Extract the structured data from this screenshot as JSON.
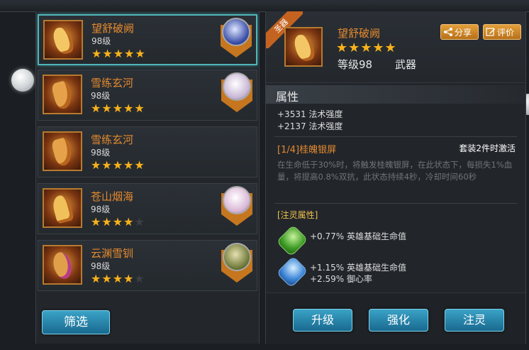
{
  "list": {
    "items": [
      {
        "name": "望舒破阙",
        "level": "98级",
        "stars_on": "★★★★★",
        "stars_off": "",
        "owner_color": "#3b4fa8"
      },
      {
        "name": "雪练玄河",
        "level": "98级",
        "stars_on": "★★★★★",
        "stars_off": "",
        "owner_color": "#c9b7d6"
      },
      {
        "name": "雪练玄河",
        "level": "98级",
        "stars_on": "★★★★★",
        "stars_off": ""
      },
      {
        "name": "苍山烟海",
        "level": "98级",
        "stars_on": "★★★★",
        "stars_off": "★",
        "owner_color": "#d9b7d6"
      },
      {
        "name": "云渊雪钏",
        "level": "98级",
        "stars_on": "★★★★",
        "stars_off": "★",
        "owner_color": "#6f7a3a"
      }
    ],
    "filter_label": "筛选"
  },
  "detail": {
    "ribbon": "圣器",
    "name": "望舒破阙",
    "stars": "★★★★★",
    "level": "等级98",
    "type": "武器",
    "share_label": "分享",
    "review_label": "评价",
    "section_title": "属性",
    "attributes": [
      "+3531 法术强度",
      "+2137 法术强度"
    ],
    "set_name": "[1/4]桂魄银屏",
    "set_condition": "套装2件时激活",
    "set_description": "在生命低于30%时，将触发桂魄银屏，在此状态下，每损失1%血量，将提高0.8%双抗，此状态持续4秒，冷却时间60秒",
    "spirit_title": "[注灵属性]",
    "spirit_lines": [
      "+0.77% 英雄基础生命值",
      "+1.15% 英雄基础生命值",
      "+2.59% 御心率"
    ],
    "buttons": {
      "upgrade": "升级",
      "strengthen": "强化",
      "infuse": "注灵"
    }
  },
  "colors": {
    "accent_orange": "#e58a2e",
    "star": "#f7b21b",
    "button_blue": "#2a88b0",
    "selected_border": "#4fb6b9"
  }
}
